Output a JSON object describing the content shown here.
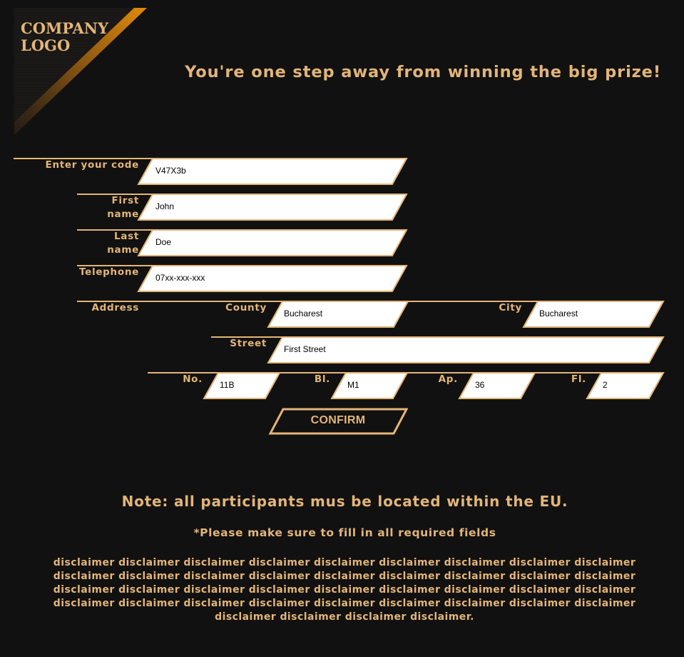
{
  "logo": {
    "text": "COMPANY\nLOGO"
  },
  "headline": "You're one step away from winning the big prize!",
  "form": {
    "code": {
      "label": "Enter your code",
      "value": "V47X3b"
    },
    "first_name": {
      "label": "First\nname",
      "value": "John"
    },
    "last_name": {
      "label": "Last\nname",
      "value": "Doe"
    },
    "telephone": {
      "label": "Telephone",
      "value": "07xx-xxx-xxx"
    },
    "address": {
      "label": "Address",
      "county": {
        "label": "County",
        "value": "Bucharest"
      },
      "city": {
        "label": "City",
        "value": "Bucharest"
      },
      "street": {
        "label": "Street",
        "value": "First Street"
      },
      "number": {
        "label": "No.",
        "value": "11B"
      },
      "block": {
        "label": "Bl.",
        "value": "M1"
      },
      "apartment": {
        "label": "Ap.",
        "value": "36"
      },
      "floor": {
        "label": "Fl.",
        "value": "2"
      }
    },
    "confirm_label": "CONFIRM"
  },
  "note": "Note: all participants mus be located within the EU.",
  "required_note": "*Please make sure to fill in all required fields",
  "disclaimer": "disclaimer disclaimer disclaimer disclaimer disclaimer disclaimer disclaimer disclaimer disclaimer disclaimer disclaimer disclaimer disclaimer disclaimer disclaimer disclaimer disclaimer disclaimer disclaimer disclaimer disclaimer disclaimer disclaimer disclaimer disclaimer disclaimer disclaimer disclaimer disclaimer disclaimer disclaimer disclaimer disclaimer disclaimer disclaimer disclaimer disclaimer disclaimer disclaimer disclaimer.",
  "colors": {
    "background": "#121111",
    "accent": "#e2b578",
    "logo_gradient": "#e28a0c",
    "field": "#ffffff"
  }
}
